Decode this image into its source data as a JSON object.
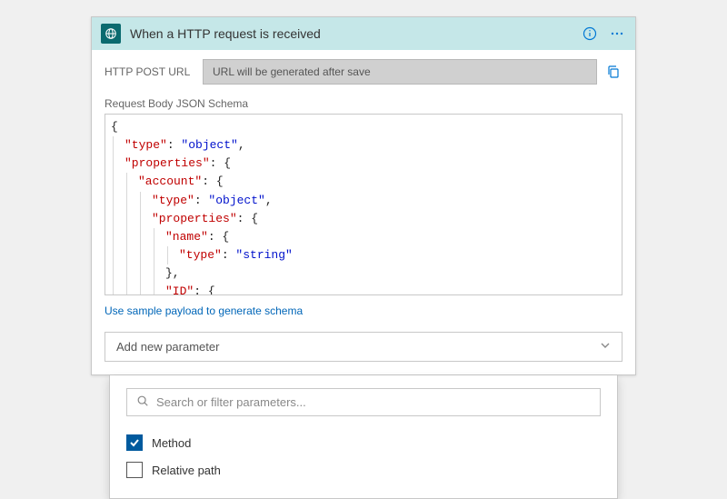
{
  "header": {
    "title": "When a HTTP request is received"
  },
  "url": {
    "label": "HTTP POST URL",
    "value": "URL will be generated after save"
  },
  "schema": {
    "label": "Request Body JSON Schema",
    "lines": [
      {
        "i": 0,
        "t": [
          {
            "c": "j-punc",
            "v": "{"
          }
        ]
      },
      {
        "i": 1,
        "t": [
          {
            "c": "j-key",
            "v": "\"type\""
          },
          {
            "c": "j-punc",
            "v": ": "
          },
          {
            "c": "j-str",
            "v": "\"object\""
          },
          {
            "c": "j-punc",
            "v": ","
          }
        ]
      },
      {
        "i": 1,
        "t": [
          {
            "c": "j-key",
            "v": "\"properties\""
          },
          {
            "c": "j-punc",
            "v": ": {"
          }
        ]
      },
      {
        "i": 2,
        "t": [
          {
            "c": "j-key",
            "v": "\"account\""
          },
          {
            "c": "j-punc",
            "v": ": {"
          }
        ]
      },
      {
        "i": 3,
        "t": [
          {
            "c": "j-key",
            "v": "\"type\""
          },
          {
            "c": "j-punc",
            "v": ": "
          },
          {
            "c": "j-str",
            "v": "\"object\""
          },
          {
            "c": "j-punc",
            "v": ","
          }
        ]
      },
      {
        "i": 3,
        "t": [
          {
            "c": "j-key",
            "v": "\"properties\""
          },
          {
            "c": "j-punc",
            "v": ": {"
          }
        ]
      },
      {
        "i": 4,
        "t": [
          {
            "c": "j-key",
            "v": "\"name\""
          },
          {
            "c": "j-punc",
            "v": ": {"
          }
        ]
      },
      {
        "i": 5,
        "t": [
          {
            "c": "j-key",
            "v": "\"type\""
          },
          {
            "c": "j-punc",
            "v": ": "
          },
          {
            "c": "j-str",
            "v": "\"string\""
          }
        ]
      },
      {
        "i": 4,
        "t": [
          {
            "c": "j-punc",
            "v": "},"
          }
        ]
      },
      {
        "i": 4,
        "t": [
          {
            "c": "j-key",
            "v": "\"ID\""
          },
          {
            "c": "j-punc",
            "v": ": {"
          }
        ]
      }
    ]
  },
  "sample_link": "Use sample payload to generate schema",
  "add_param_label": "Add new parameter",
  "dropdown": {
    "search_placeholder": "Search or filter parameters...",
    "options": [
      {
        "label": "Method",
        "checked": true
      },
      {
        "label": "Relative path",
        "checked": false
      }
    ]
  }
}
